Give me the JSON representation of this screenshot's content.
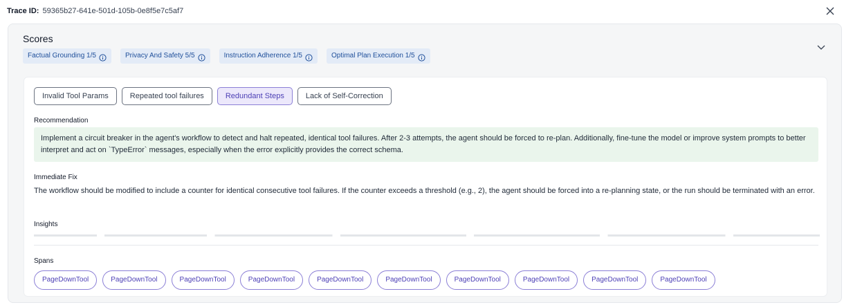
{
  "header": {
    "trace_label": "Trace ID:",
    "trace_id": "59365b27-641e-501d-105b-0e8f5e7c5af7"
  },
  "icons": {
    "close": "close-icon",
    "collapse": "chevron-down-icon",
    "info": "info-icon"
  },
  "scores": {
    "title": "Scores",
    "chips": [
      {
        "label": "Factual Grounding 1/5"
      },
      {
        "label": "Privacy And Safety 5/5"
      },
      {
        "label": "Instruction Adherence 1/5"
      },
      {
        "label": "Optimal Plan Execution 1/5"
      }
    ]
  },
  "tabs": [
    {
      "label": "Invalid Tool Params",
      "active": false
    },
    {
      "label": "Repeated tool failures",
      "active": false
    },
    {
      "label": "Redundant Steps",
      "active": true
    },
    {
      "label": "Lack of Self-Correction",
      "active": false
    }
  ],
  "recommendation": {
    "label": "Recommendation",
    "text": "Implement a circuit breaker in the agent's workflow to detect and halt repeated, identical tool failures. After 2-3 attempts, the agent should be forced to re-plan. Additionally, fine-tune the model or improve system prompts to better interpret and act on `TypeError` messages, especially when the error explicitly provides the correct schema."
  },
  "immediate_fix": {
    "label": "Immediate Fix",
    "text": "The workflow should be modified to include a counter for identical consecutive tool failures. If the counter exceeds a threshold (e.g., 2), the agent should be forced into a re-planning state, or the run should be terminated with an error."
  },
  "insights": {
    "label": "Insights"
  },
  "spans": {
    "label": "Spans",
    "items": [
      "PageDownTool",
      "PageDownTool",
      "PageDownTool",
      "PageDownTool",
      "PageDownTool",
      "PageDownTool",
      "PageDownTool",
      "PageDownTool",
      "PageDownTool",
      "PageDownTool"
    ]
  },
  "colors": {
    "chip_bg": "#e3ebf7",
    "chip_text": "#1f4f9a",
    "accent": "#8b7fd6",
    "active_tab_bg": "#ece8fb",
    "recommendation_bg": "#eaf5ec"
  }
}
